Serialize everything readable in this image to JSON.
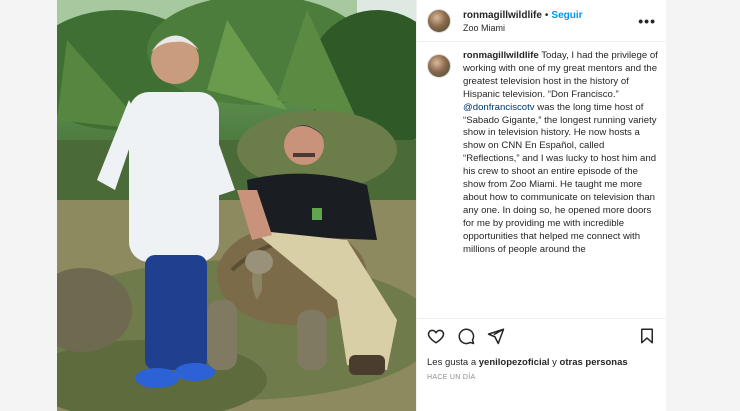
{
  "post": {
    "username": "ronmagillwildlife",
    "separator": "•",
    "follow_label": "Seguir",
    "location": "Zoo Miami",
    "more_label": "•••",
    "caption_username": "ronmagillwildlife",
    "caption_part1": "Today, I had the privilege of working with one of my great mentors and the greatest television host in the history of Hispanic television. “Don Francisco.” ",
    "caption_mention": "@donfranciscotv",
    "caption_part2": " was the long time host of “Sabado Gigante,” the longest running variety show in television history. He now hosts a show on CNN En Español, called “Reflections,” and I was lucky to host him and his crew to shoot an entire episode of the show from Zoo Miami. He taught me more about how to communicate on television than any one. In doing so, he opened more doors for me by providing me with incredible opportunities that helped me connect with millions of people around the",
    "likes_prefix": "Les gusta a ",
    "likes_user": "yenilopezoficial",
    "likes_suffix": " y ",
    "likes_others": "otras personas",
    "date": "HACE UN DÍA"
  },
  "icons": {
    "like": "heart-icon",
    "comment": "comment-icon",
    "share": "share-icon",
    "save": "bookmark-icon"
  },
  "colors": {
    "follow": "#0095f6",
    "mention": "#00376b",
    "muted": "#8e8e8e"
  }
}
